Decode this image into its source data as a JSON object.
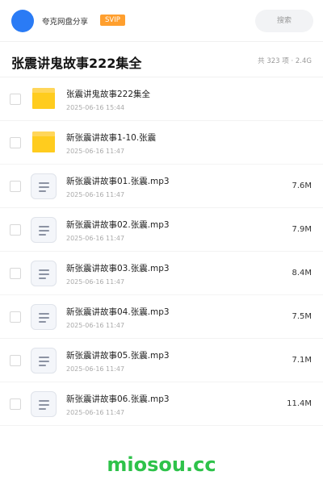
{
  "header": {
    "brand": "夸克网盘分享",
    "badge": "SVIP",
    "search_placeholder": "搜索"
  },
  "folder": {
    "title": "张震讲鬼故事222集全",
    "meta": "共 323 项 · 2.4G"
  },
  "items": [
    {
      "type": "folder",
      "name": "张震讲鬼故事222集全",
      "date": "2025-06-16 15:44",
      "size": ""
    },
    {
      "type": "folder",
      "name": "新张震讲故事1-10.张震",
      "date": "2025-06-16 11:47",
      "size": ""
    },
    {
      "type": "file",
      "name": "新张震讲故事01.张震.mp3",
      "date": "2025-06-16 11:47",
      "size": "7.6M"
    },
    {
      "type": "file",
      "name": "新张震讲故事02.张震.mp3",
      "date": "2025-06-16 11:47",
      "size": "7.9M"
    },
    {
      "type": "file",
      "name": "新张震讲故事03.张震.mp3",
      "date": "2025-06-16 11:47",
      "size": "8.4M"
    },
    {
      "type": "file",
      "name": "新张震讲故事04.张震.mp3",
      "date": "2025-06-16 11:47",
      "size": "7.5M"
    },
    {
      "type": "file",
      "name": "新张震讲故事05.张震.mp3",
      "date": "2025-06-16 11:47",
      "size": "7.1M"
    },
    {
      "type": "file",
      "name": "新张震讲故事06.张震.mp3",
      "date": "2025-06-16 11:47",
      "size": "11.4M"
    }
  ],
  "icons": {
    "folder": "folder-icon",
    "file": "audio-file-icon"
  },
  "colors": {
    "avatar": "#2a7bf5",
    "badge": "#ff9f2e",
    "folder": "#ffcc1e",
    "watermark": "#2ec24a"
  },
  "watermark": "miosou.cc"
}
